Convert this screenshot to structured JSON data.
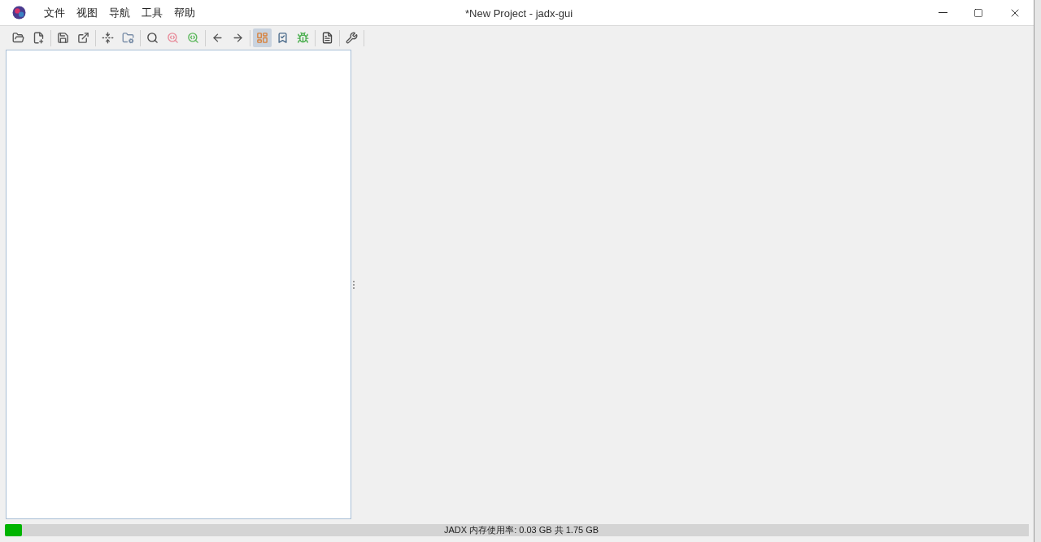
{
  "window": {
    "title": "*New Project - jadx-gui"
  },
  "menu": [
    "文件",
    "视图",
    "导航",
    "工具",
    "帮助"
  ],
  "toolbar_groups": [
    [
      {
        "selected": false
      },
      {
        "selected": false
      }
    ],
    [
      {
        "selected": false
      },
      {
        "selected": false
      }
    ],
    [
      {
        "selected": false
      },
      {
        "selected": false
      }
    ],
    [
      {
        "selected": false
      },
      {
        "selected": false
      },
      {
        "selected": false
      }
    ],
    [
      {
        "selected": false
      },
      {
        "selected": false
      }
    ],
    [
      {
        "selected": true
      },
      {
        "selected": false
      },
      {
        "selected": false
      }
    ],
    [
      {
        "selected": false
      }
    ],
    [
      {
        "selected": false
      }
    ]
  ],
  "memory": {
    "level": 0.017,
    "reading": "JADX 内存使用率: 0.03 GB 共 1.75 GB"
  }
}
